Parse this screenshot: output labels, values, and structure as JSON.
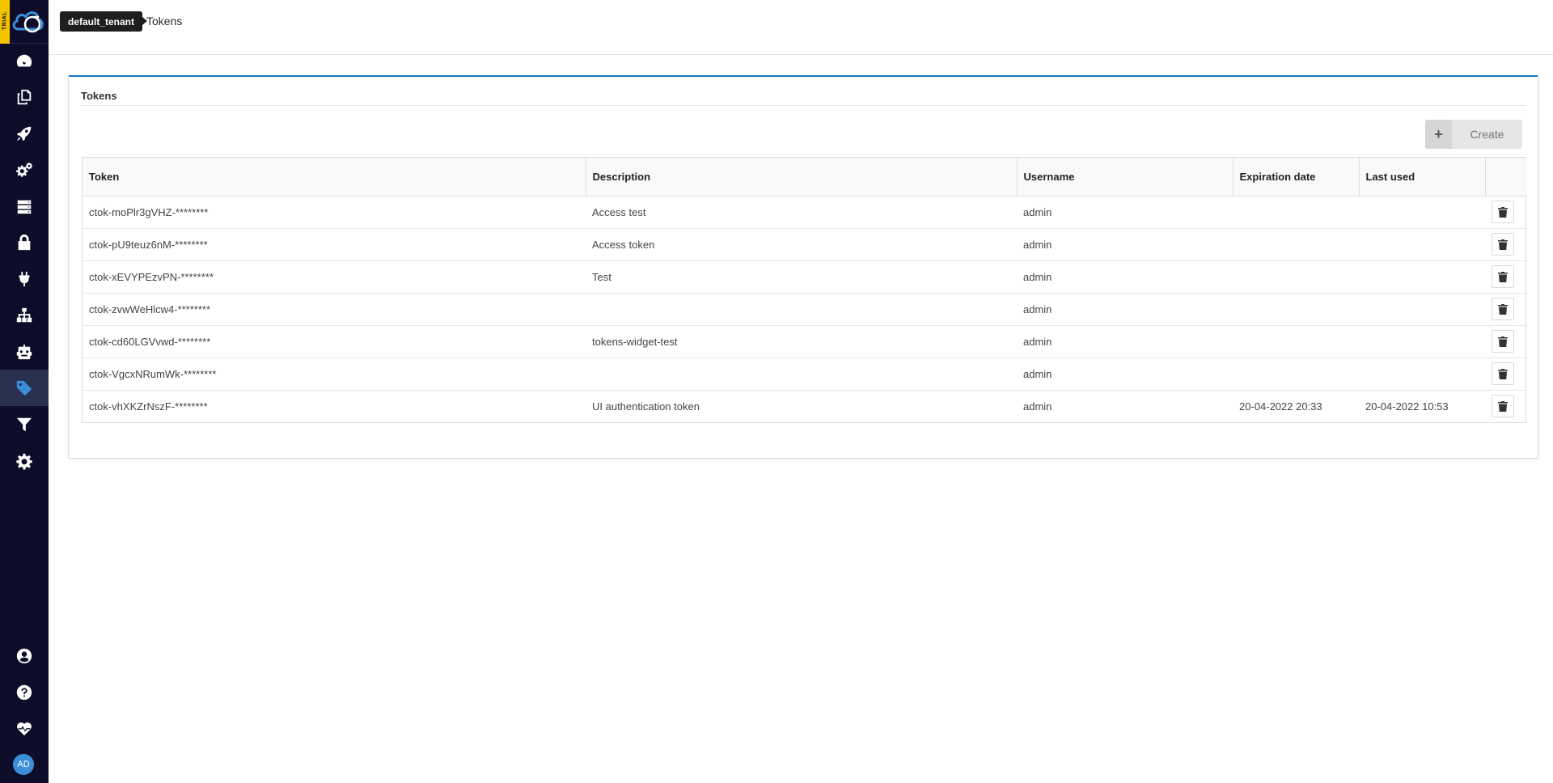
{
  "app": {
    "trial_badge": "TRIAL",
    "user_initials": "AD"
  },
  "breadcrumb": {
    "tenant": "default_tenant",
    "page": "Tokens"
  },
  "card": {
    "title": "Tokens",
    "create_label": "Create"
  },
  "table": {
    "columns": [
      "Token",
      "Description",
      "Username",
      "Expiration date",
      "Last used"
    ],
    "rows": [
      {
        "token": "ctok-moPlr3gVHZ-********",
        "description": "Access test",
        "username": "admin",
        "expiration": "",
        "last_used": ""
      },
      {
        "token": "ctok-pU9teuz6nM-********",
        "description": "Access token",
        "username": "admin",
        "expiration": "",
        "last_used": ""
      },
      {
        "token": "ctok-xEVYPEzvPN-********",
        "description": "Test",
        "username": "admin",
        "expiration": "",
        "last_used": ""
      },
      {
        "token": "ctok-zvwWeHlcw4-********",
        "description": "",
        "username": "admin",
        "expiration": "",
        "last_used": ""
      },
      {
        "token": "ctok-cd60LGVvwd-********",
        "description": "tokens-widget-test",
        "username": "admin",
        "expiration": "",
        "last_used": ""
      },
      {
        "token": "ctok-VgcxNRumWk-********",
        "description": "",
        "username": "admin",
        "expiration": "",
        "last_used": ""
      },
      {
        "token": "ctok-vhXKZrNszF-********",
        "description": "UI authentication token",
        "username": "admin",
        "expiration": "20-04-2022 20:33",
        "last_used": "20-04-2022 10:53"
      }
    ]
  },
  "sidebar": {
    "items": [
      {
        "icon": "dashboard-icon",
        "active": false
      },
      {
        "icon": "copy-icon",
        "active": false
      },
      {
        "icon": "rocket-icon",
        "active": false
      },
      {
        "icon": "cogs-icon",
        "active": false
      },
      {
        "icon": "server-icon",
        "active": false
      },
      {
        "icon": "lock-icon",
        "active": false
      },
      {
        "icon": "plug-icon",
        "active": false
      },
      {
        "icon": "sitemap-icon",
        "active": false
      },
      {
        "icon": "robot-icon",
        "active": false
      },
      {
        "icon": "tag-icon",
        "active": true
      },
      {
        "icon": "filter-icon",
        "active": false
      },
      {
        "icon": "settings-icon",
        "active": false
      }
    ],
    "bottom_items": [
      {
        "icon": "user-circle-icon"
      },
      {
        "icon": "help-icon"
      },
      {
        "icon": "heartbeat-icon"
      }
    ]
  },
  "colors": {
    "sidebar_bg": "#0d0d29",
    "trial_badge": "#f5c400",
    "accent": "#1776bf",
    "avatar_bg": "#3b8fd9"
  }
}
